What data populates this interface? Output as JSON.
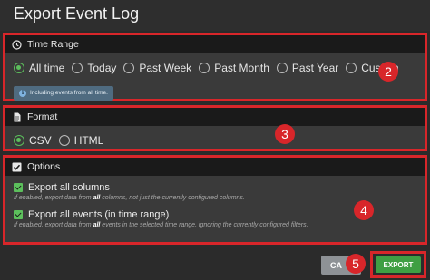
{
  "dialog": {
    "title": "Export Event Log"
  },
  "time_range": {
    "heading": "Time Range",
    "icon": "clock-icon",
    "options": [
      "All time",
      "Today",
      "Past Week",
      "Past Month",
      "Past Year",
      "Custom"
    ],
    "selected": "All time",
    "info": "Including events from all time."
  },
  "format": {
    "heading": "Format",
    "icon": "document-icon",
    "options": [
      "CSV",
      "HTML"
    ],
    "selected": "CSV"
  },
  "options": {
    "heading": "Options",
    "icon": "checkbox-icon",
    "export_all_columns": {
      "label": "Export all columns",
      "checked": true,
      "help_pre": "If enabled, export data from ",
      "help_bold": "all",
      "help_post": " columns, not just the currently configured columns."
    },
    "export_all_events": {
      "label": "Export all events (in time range)",
      "checked": true,
      "help_pre": "If enabled, export data from ",
      "help_bold": "all",
      "help_post": " events in the selected time range, ignoring the currently configured filters."
    }
  },
  "callouts": [
    "2",
    "3",
    "4",
    "5"
  ],
  "footer": {
    "cancel_label": "CA",
    "export_label": "EXPORT"
  },
  "colors": {
    "highlight": "#d8262a",
    "accent": "#5cbf5c",
    "export": "#3f9f43",
    "info": "#4f6b80"
  }
}
